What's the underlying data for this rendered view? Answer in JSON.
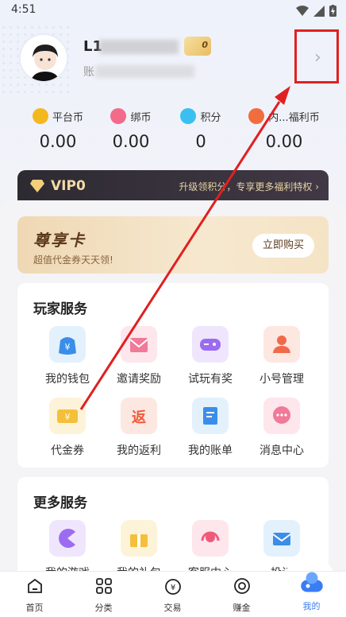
{
  "status": {
    "time": "4:51"
  },
  "profile": {
    "name_prefix": "L1",
    "vip_badge": "0",
    "account_prefix": "账"
  },
  "coins": [
    {
      "label": "平台币",
      "value": "0.00",
      "color": "#f4b81f"
    },
    {
      "label": "绑币",
      "value": "0.00",
      "color": "#f36b8a"
    },
    {
      "label": "积分",
      "value": "0",
      "color": "#39c0f0"
    },
    {
      "label": "内部福利币",
      "label_visible": "内...福利币",
      "value": "0.00",
      "color": "#f26d3d"
    }
  ],
  "vip": {
    "title": "VIP0",
    "desc": "升级领积分，专享更多福利特权 ›"
  },
  "premium_card": {
    "title": "尊享卡",
    "subtitle": "超值代金券天天领!",
    "button": "立即购买"
  },
  "player_services": {
    "title": "玩家服务",
    "items": [
      {
        "label": "我的钱包",
        "icon": "wallet-icon"
      },
      {
        "label": "邀请奖励",
        "icon": "invite-icon"
      },
      {
        "label": "试玩有奖",
        "icon": "gamepad-icon"
      },
      {
        "label": "小号管理",
        "icon": "account-icon"
      },
      {
        "label": "代金券",
        "icon": "voucher-icon"
      },
      {
        "label": "我的返利",
        "icon": "rebate-icon"
      },
      {
        "label": "我的账单",
        "icon": "bill-icon"
      },
      {
        "label": "消息中心",
        "icon": "message-icon"
      }
    ]
  },
  "more_services": {
    "title": "更多服务",
    "items": [
      {
        "label": "我的游戏",
        "icon": "game-icon"
      },
      {
        "label": "我的礼包",
        "icon": "gift-icon"
      },
      {
        "label": "客服中心",
        "icon": "headset-icon"
      },
      {
        "label": "投诉",
        "icon": "complaint-icon"
      }
    ]
  },
  "tabs": [
    {
      "label": "首页",
      "icon": "home-icon"
    },
    {
      "label": "分类",
      "icon": "category-icon"
    },
    {
      "label": "交易",
      "icon": "trade-icon"
    },
    {
      "label": "赚金",
      "icon": "earn-icon"
    },
    {
      "label": "我的",
      "icon": "me-icon",
      "active": true
    }
  ],
  "colors": {
    "accent": "#3a7cf4",
    "annotation": "#e02020",
    "vip_gold": "#f3dba5"
  }
}
